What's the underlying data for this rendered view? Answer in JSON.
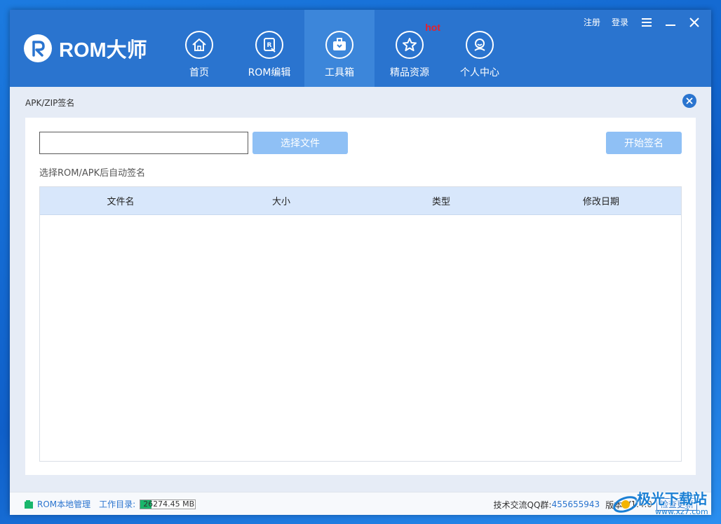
{
  "app": {
    "logo_text": "ROM大师",
    "accent_color": "#2a74cf"
  },
  "header": {
    "links": {
      "register": "注册",
      "login": "登录"
    },
    "nav": [
      {
        "label": "首页",
        "icon": "home-icon"
      },
      {
        "label": "ROM编辑",
        "icon": "rom-edit-icon"
      },
      {
        "label": "工具箱",
        "icon": "toolbox-icon",
        "active": true
      },
      {
        "label": "精品资源",
        "icon": "star-icon",
        "badge": "hot"
      },
      {
        "label": "个人中心",
        "icon": "user-icon"
      }
    ]
  },
  "tool": {
    "title": "APK/ZIP签名",
    "file_input_value": "",
    "choose_button": "选择文件",
    "sign_button": "开始签名",
    "hint": "选择ROM/APK后自动签名",
    "columns": [
      "文件名",
      "大小",
      "类型",
      "修改日期"
    ],
    "rows": []
  },
  "status": {
    "local_manage": "ROM本地管理",
    "workdir_label": "工作目录:",
    "disk_text": "26274.45 MB",
    "disk_fill_fraction": 0.2,
    "qq_label": "技术交流QQ群:",
    "qq_number": "455655943",
    "version_label": "版本:",
    "version": "V1.4.0",
    "update_button": "检查更新"
  },
  "watermark": {
    "text": "极光下载站",
    "sub": "www.xz7.com"
  }
}
